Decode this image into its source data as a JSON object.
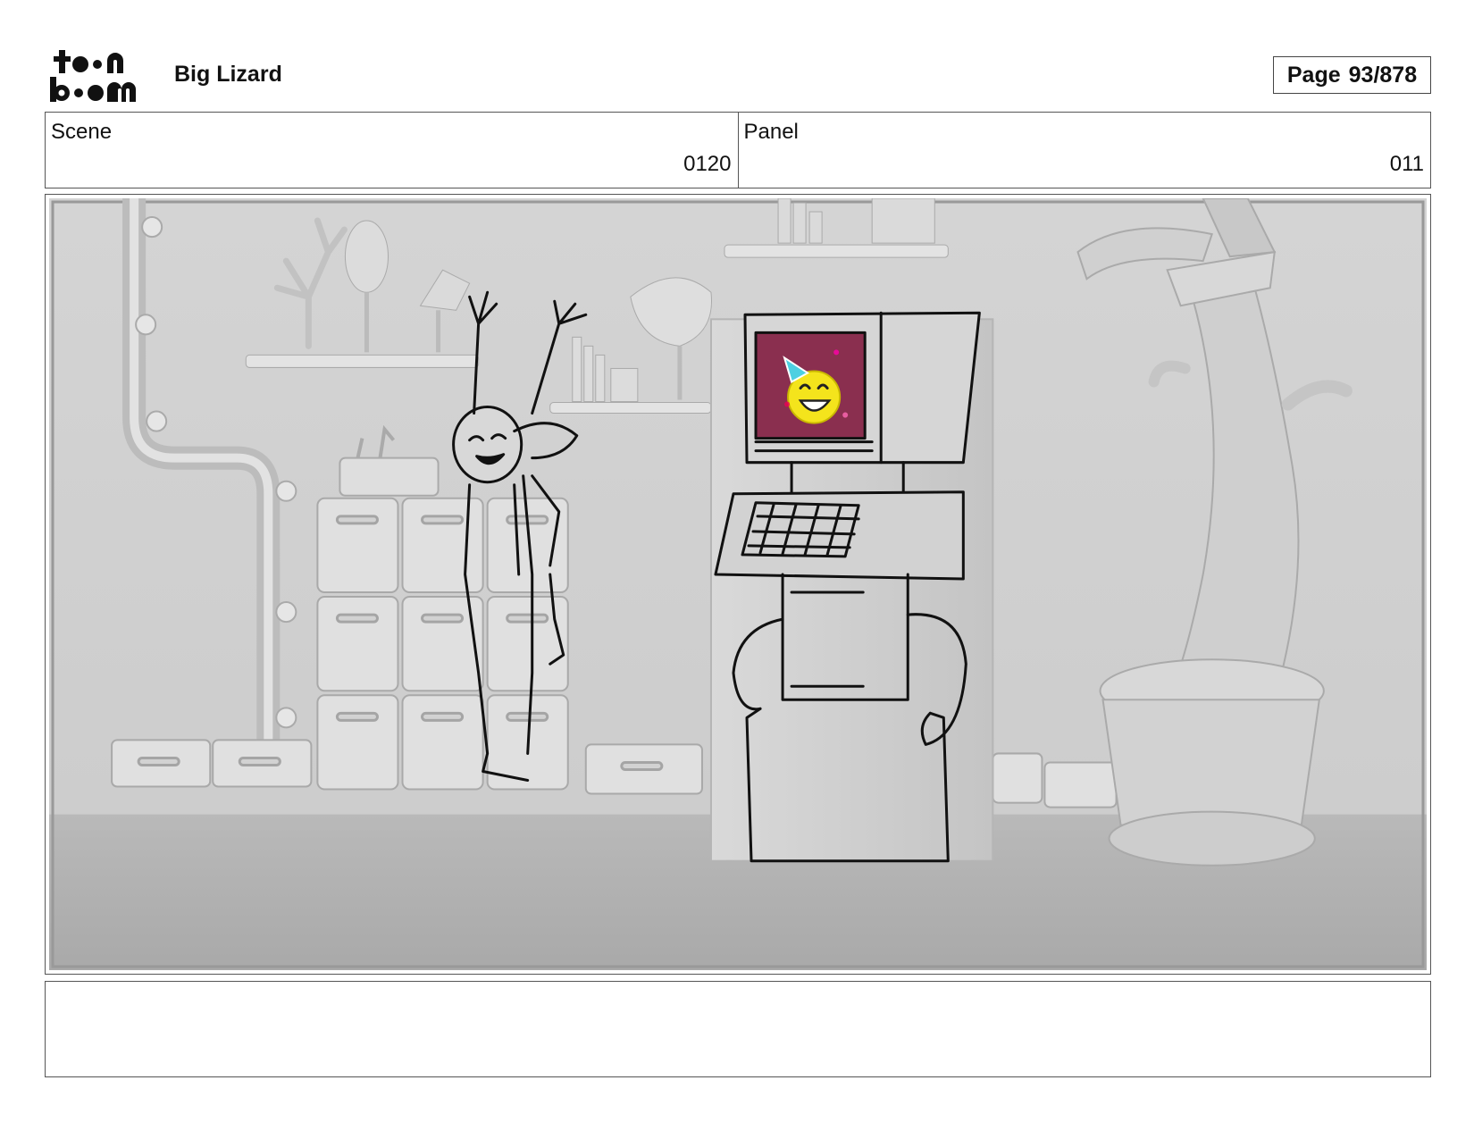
{
  "header": {
    "logo_text_top": "toon",
    "logo_text_bottom": "boom",
    "project_title": "Big Lizard",
    "page_label": "Page",
    "page_value": "93/878"
  },
  "meta": {
    "scene_label": "Scene",
    "scene_value": "0120",
    "panel_label": "Panel",
    "panel_value": "011"
  },
  "panel_image": {
    "screen_color": "#8a2f4f",
    "emoji_color": "#f4e41c"
  },
  "notes": {
    "text": ""
  }
}
